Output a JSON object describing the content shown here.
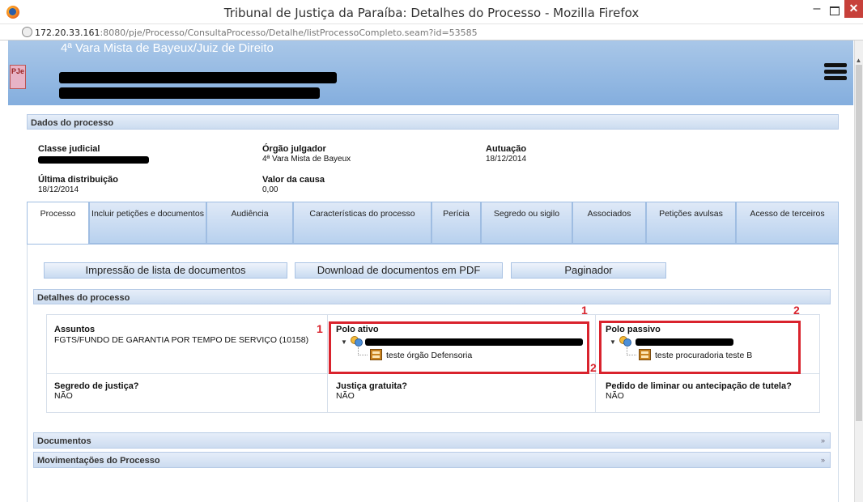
{
  "window": {
    "title": "Tribunal de Justiça da Paraíba: Detalhes do Processo - Mozilla Firefox",
    "close_label": "✕",
    "min_label": "–"
  },
  "urlbar": {
    "host": "172.20.33.161",
    "path": ":8080/pje/Processo/ConsultaProcesso/Detalhe/listProcessoCompleto.seam?id=53585"
  },
  "header": {
    "logo_text": "PJe",
    "vara": "4ª Vara Mista de Bayeux/Juiz de Direito"
  },
  "dados": {
    "title": "Dados do processo",
    "classe_label": "Classe judicial",
    "orgao_label": "Órgão julgador",
    "orgao_value": "4ª Vara Mista de Bayeux",
    "autuacao_label": "Autuação",
    "autuacao_value": "18/12/2014",
    "ultima_label": "Última distribuição",
    "ultima_value": "18/12/2014",
    "valor_label": "Valor da causa",
    "valor_value": "0,00"
  },
  "tabs": [
    {
      "label": "Processo"
    },
    {
      "label": "Incluir petições e documentos"
    },
    {
      "label": "Audiência"
    },
    {
      "label": "Características do processo"
    },
    {
      "label": "Perícia"
    },
    {
      "label": "Segredo ou sigilo"
    },
    {
      "label": "Associados"
    },
    {
      "label": "Petições avulsas"
    },
    {
      "label": "Acesso de terceiros"
    }
  ],
  "actions": {
    "impressao": "Impressão de lista de documentos",
    "download": "Download de documentos em PDF",
    "paginador": "Paginador"
  },
  "detalhes": {
    "title": "Detalhes do processo",
    "assuntos_label": "Assuntos",
    "assuntos_value": "FGTS/FUNDO DE GARANTIA POR TEMPO DE SERVIÇO (10158)",
    "polo_ativo_label": "Polo ativo",
    "polo_ativo_org": "teste órgão Defensoria",
    "polo_passivo_label": "Polo passivo",
    "polo_passivo_org": "teste procuradoria teste B",
    "segredo_label": "Segredo de justiça?",
    "segredo_value": "NÃO",
    "gratuita_label": "Justiça gratuita?",
    "gratuita_value": "NÃO",
    "liminar_label": "Pedido de liminar ou antecipação de tutela?",
    "liminar_value": "NÃO"
  },
  "annotations": {
    "n1": "1",
    "n2": "2"
  },
  "panels": {
    "documentos": "Documentos",
    "movimentacoes": "Movimentações do Processo",
    "expand": "»"
  },
  "colors": {
    "highlight": "#d9232d",
    "header_blue": "#84aede"
  }
}
